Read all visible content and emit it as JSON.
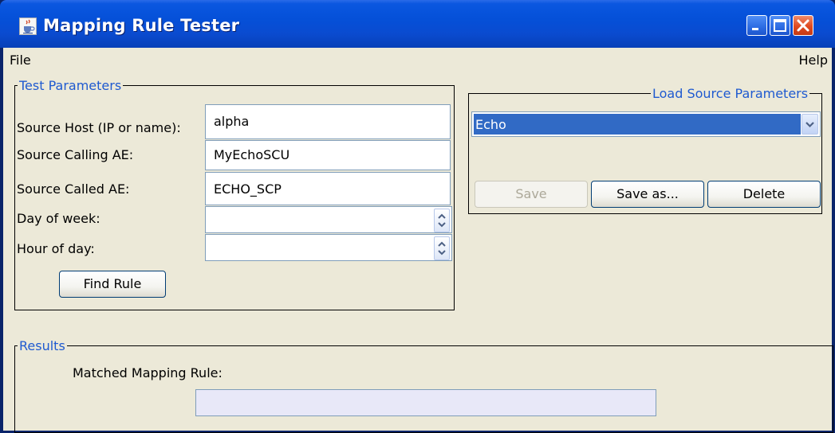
{
  "window": {
    "title": "Mapping Rule Tester",
    "title_icon": "java-cup-icon"
  },
  "menubar": {
    "file": "File",
    "help": "Help"
  },
  "test_parameters": {
    "title": "Test Parameters",
    "source_host_label": "Source Host (IP or name):",
    "source_host_value": "alpha",
    "calling_ae_label": "Source Calling AE:",
    "calling_ae_value": "MyEchoSCU",
    "called_ae_label": "Source Called AE:",
    "called_ae_value": "ECHO_SCP",
    "day_of_week_label": "Day of week:",
    "day_of_week_value": "",
    "hour_of_day_label": "Hour of day:",
    "hour_of_day_value": "",
    "find_rule_label": "Find Rule"
  },
  "load_source": {
    "title": "Load Source Parameters",
    "selected": "Echo",
    "save_label": "Save",
    "save_as_label": "Save as...",
    "delete_label": "Delete"
  },
  "results": {
    "title": "Results",
    "matched_label": "Matched Mapping Rule:",
    "matched_value": ""
  },
  "colors": {
    "titlebar": "#0550d8",
    "group_title": "#1f5ad0",
    "selection": "#316ac5",
    "window_bg": "#ece9d8"
  }
}
